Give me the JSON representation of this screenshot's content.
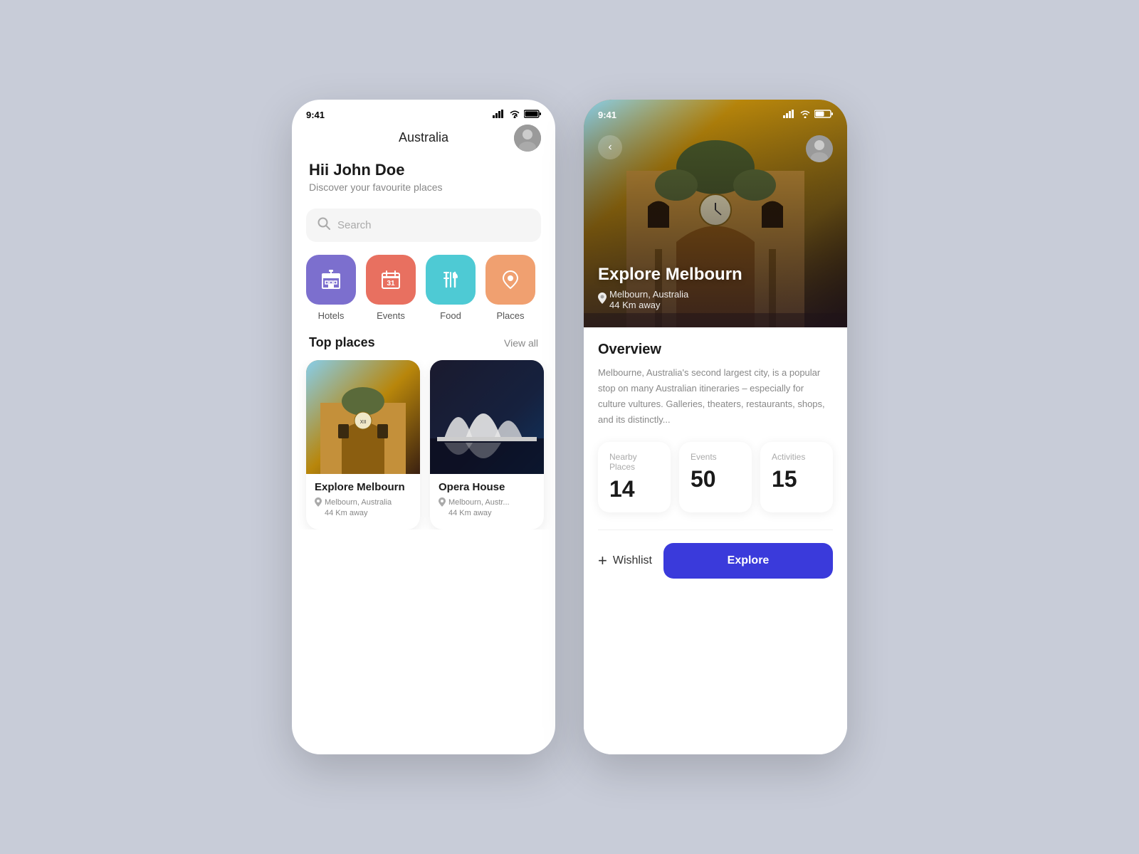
{
  "phone1": {
    "statusBar": {
      "time": "9:41",
      "signal": "▲▲▲",
      "wifi": "WiFi",
      "battery": "🔋"
    },
    "header": {
      "title": "Australia",
      "avatarAlt": "User avatar"
    },
    "greeting": {
      "name": "Hii John Doe",
      "subtitle": "Discover your favourite places"
    },
    "search": {
      "placeholder": "Search"
    },
    "categories": [
      {
        "id": "hotels",
        "label": "Hotels",
        "colorClass": "cat-hotels"
      },
      {
        "id": "events",
        "label": "Events",
        "colorClass": "cat-events"
      },
      {
        "id": "food",
        "label": "Food",
        "colorClass": "cat-food"
      },
      {
        "id": "places",
        "label": "Places",
        "colorClass": "cat-places"
      }
    ],
    "topPlaces": {
      "title": "Top places",
      "viewAll": "View all",
      "items": [
        {
          "name": "Explore Melbourn",
          "location": "Melbourn, Australia",
          "distance": "44 Km away"
        },
        {
          "name": "Opera House",
          "location": "Melbourn, Austr...",
          "distance": "44 Km away"
        }
      ]
    }
  },
  "phone2": {
    "statusBar": {
      "time": "9:41"
    },
    "hero": {
      "title": "Explore Melbourn",
      "location": "Melbourn, Australia",
      "distance": "44 Km away"
    },
    "overview": {
      "title": "Overview",
      "text": "Melbourne, Australia's second largest city, is a popular stop on many Australian itineraries – especially for culture vultures. Galleries, theaters, restaurants, shops, and its distinctly..."
    },
    "stats": [
      {
        "label": "Nearby Places",
        "value": "14"
      },
      {
        "label": "Events",
        "value": "50"
      },
      {
        "label": "Activities",
        "value": "15"
      }
    ],
    "actions": {
      "wishlist": "Wishlist",
      "explore": "Explore"
    }
  }
}
